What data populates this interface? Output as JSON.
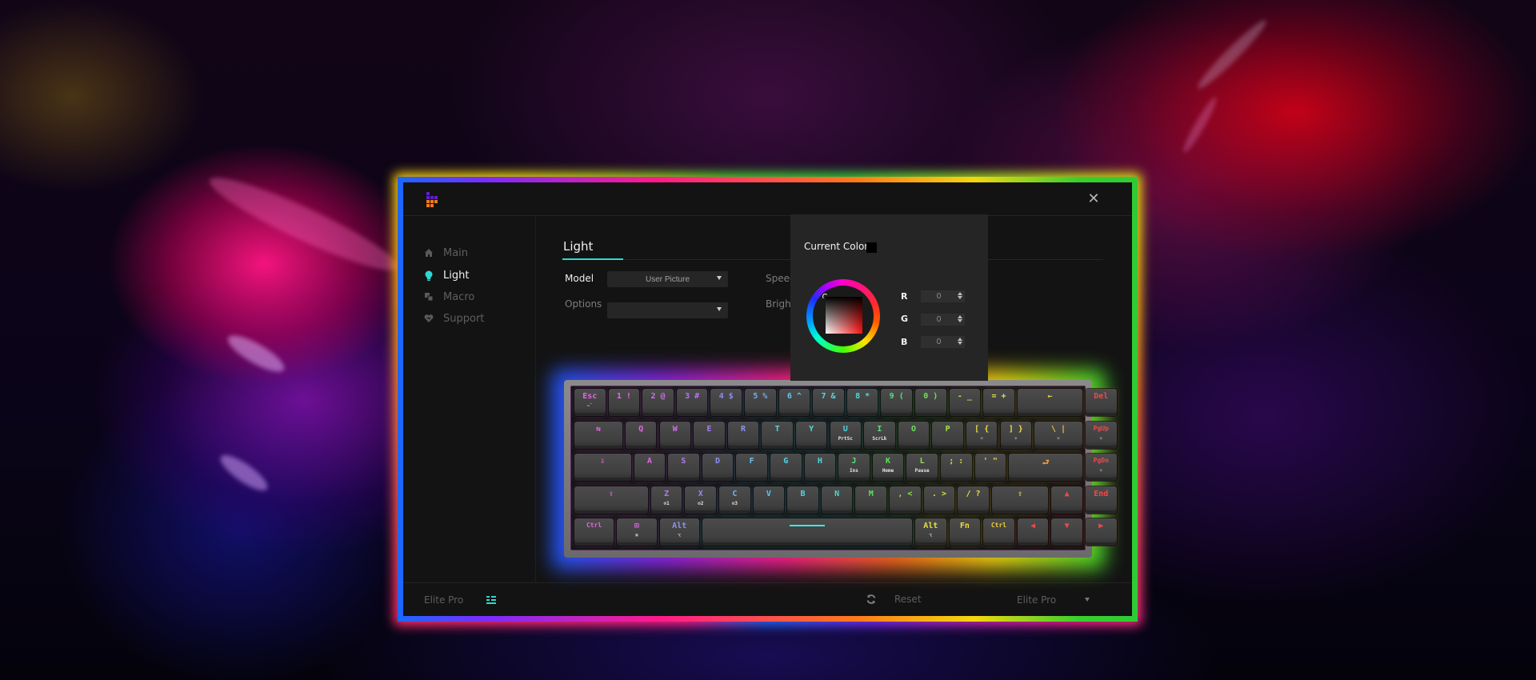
{
  "app": {
    "logo_name": "brand-logo",
    "close_label": "✕",
    "accent_color": "#2ed8d2",
    "logo_colors": [
      "#5d1fd0",
      "#f07a1a"
    ]
  },
  "sidebar": {
    "items": [
      {
        "label": "Main",
        "icon": "home-icon",
        "active": false
      },
      {
        "label": "Light",
        "icon": "lightbulb-icon",
        "active": true
      },
      {
        "label": "Macro",
        "icon": "macro-icon",
        "active": false
      },
      {
        "label": "Support",
        "icon": "heart-icon",
        "active": false
      }
    ]
  },
  "main": {
    "tab_title": "Light",
    "model_label": "Model",
    "model_value": "User Picture",
    "options_label": "Options",
    "options_value": "",
    "speed_label": "Speed",
    "brightness_label": "Brightr"
  },
  "color_picker": {
    "title": "Current Color",
    "current_color": "#000000",
    "channels": [
      {
        "label": "R",
        "value": "0"
      },
      {
        "label": "G",
        "value": "0"
      },
      {
        "label": "B",
        "value": "0"
      }
    ]
  },
  "footer": {
    "device_name": "Elite Pro",
    "reset_label": "Reset",
    "profile_value": "Elite Pro"
  },
  "keyboard": {
    "rows": [
      [
        {
          "l": "Esc",
          "s": "~`",
          "c": "#e465e8",
          "w": 1
        },
        {
          "l": "1 !",
          "c": "#e46ae8",
          "w": 1
        },
        {
          "l": "2 @",
          "c": "#d170ea",
          "w": 1
        },
        {
          "l": "3 #",
          "c": "#b777ec",
          "w": 1
        },
        {
          "l": "4 $",
          "c": "#8a8cf2",
          "w": 1
        },
        {
          "l": "5 %",
          "c": "#78a8f2",
          "w": 1
        },
        {
          "l": "6 ^",
          "c": "#63c7ef",
          "w": 1
        },
        {
          "l": "7 &",
          "c": "#58d3e6",
          "w": 1
        },
        {
          "l": "8 *",
          "c": "#4fdadb",
          "w": 1
        },
        {
          "l": "9 (",
          "c": "#56e07a",
          "w": 1
        },
        {
          "l": "0 )",
          "c": "#6fe256",
          "w": 1
        },
        {
          "l": "- _",
          "c": "#b4e04a",
          "w": 1
        },
        {
          "l": "= +",
          "c": "#e4e04a",
          "w": 1
        },
        {
          "l": "←",
          "c": "#f3d93a",
          "w": 2
        },
        {
          "l": "Del",
          "c": "#ee4a4a",
          "w": 1
        }
      ],
      [
        {
          "l": "⇆",
          "c": "#e465e8",
          "w": 1.5
        },
        {
          "l": "Q",
          "c": "#e266e8",
          "w": 1
        },
        {
          "l": "W",
          "c": "#cf6fea",
          "w": 1
        },
        {
          "l": "E",
          "c": "#a27ef0",
          "w": 1
        },
        {
          "l": "R",
          "c": "#8a93f2",
          "w": 1
        },
        {
          "l": "T",
          "c": "#5fd2ea",
          "w": 1
        },
        {
          "l": "Y",
          "c": "#53d6e4",
          "w": 1
        },
        {
          "l": "U",
          "s": "PrtSc",
          "c": "#4fd2dd",
          "w": 1
        },
        {
          "l": "I",
          "s": "ScrLk",
          "c": "#58e07a",
          "w": 1
        },
        {
          "l": "O",
          "c": "#6ee25a",
          "w": 1
        },
        {
          "l": "P",
          "c": "#9fe24b",
          "w": 1
        },
        {
          "l": "[ {",
          "s": "☼",
          "c": "#e6de44",
          "w": 1
        },
        {
          "l": "] }",
          "s": "☼",
          "c": "#eedb3c",
          "w": 1
        },
        {
          "l": "\\ |",
          "s": "☼",
          "c": "#f2c53a",
          "w": 1.5
        },
        {
          "l": "PgUp",
          "s": "☼",
          "c": "#ee4a4a",
          "w": 1
        }
      ],
      [
        {
          "l": "⇩",
          "c": "#e465e8",
          "w": 1.75
        },
        {
          "l": "A",
          "c": "#e266e8",
          "w": 1
        },
        {
          "l": "S",
          "c": "#b27cee",
          "w": 1
        },
        {
          "l": "D",
          "c": "#8d8ff2",
          "w": 1
        },
        {
          "l": "F",
          "c": "#68c3f0",
          "w": 1
        },
        {
          "l": "G",
          "c": "#58d2e8",
          "w": 1
        },
        {
          "l": "H",
          "c": "#4fd6df",
          "w": 1
        },
        {
          "l": "J",
          "s": "Ins",
          "c": "#5bdf7a",
          "w": 1
        },
        {
          "l": "K",
          "s": "Home",
          "c": "#62e05a",
          "w": 1
        },
        {
          "l": "L",
          "s": "Pause",
          "c": "#8fe24f",
          "w": 1
        },
        {
          "l": "; :",
          "c": "#e4de44",
          "w": 1
        },
        {
          "l": "' \"",
          "c": "#eedb3c",
          "w": 1
        },
        {
          "l": "⮐",
          "c": "#f0a23a",
          "w": 2.25
        },
        {
          "l": "PgDn",
          "s": "☼",
          "c": "#ee4a4a",
          "w": 1
        }
      ],
      [
        {
          "l": "⇧",
          "c": "#e465e8",
          "w": 2.25
        },
        {
          "l": "Z",
          "s": "⚙1",
          "c": "#b77aee",
          "w": 1
        },
        {
          "l": "X",
          "s": "⚙2",
          "c": "#9c84f0",
          "w": 1
        },
        {
          "l": "C",
          "s": "⚙3",
          "c": "#6fb4f0",
          "w": 1
        },
        {
          "l": "V",
          "c": "#5ac7ee",
          "w": 1
        },
        {
          "l": "B",
          "c": "#52d3e4",
          "w": 1
        },
        {
          "l": "N",
          "c": "#4fd8cf",
          "w": 1
        },
        {
          "l": "M",
          "c": "#5fe05c",
          "w": 1
        },
        {
          "l": ", <",
          "c": "#8ee04d",
          "w": 1
        },
        {
          "l": ". >",
          "c": "#dcde44",
          "w": 1
        },
        {
          "l": "/ ?",
          "c": "#eedb3c",
          "w": 1
        },
        {
          "l": "⇧",
          "c": "#f3d63a",
          "w": 1.75
        },
        {
          "l": "▲",
          "c": "#ee4a4a",
          "w": 1
        },
        {
          "l": "End",
          "c": "#ee4a4a",
          "w": 1
        }
      ],
      [
        {
          "l": "Ctrl",
          "c": "#e465e8",
          "w": 1.25
        },
        {
          "l": "⊞",
          "s": "⌘",
          "c": "#e266e8",
          "w": 1.25
        },
        {
          "l": "Alt",
          "s": "⌥",
          "c": "#8a93f2",
          "w": 1.25
        },
        {
          "l": "",
          "c": "#3fe6e8",
          "w": 6.25,
          "space": true
        },
        {
          "l": "Alt",
          "s": "⌥",
          "c": "#e6de44",
          "w": 1
        },
        {
          "l": "Fn",
          "c": "#eedb3c",
          "w": 1
        },
        {
          "l": "Ctrl",
          "c": "#f0cf3a",
          "w": 1
        },
        {
          "l": "◀",
          "c": "#ee4a4a",
          "w": 1
        },
        {
          "l": "▼",
          "c": "#ee4a4a",
          "w": 1
        },
        {
          "l": "▶",
          "c": "#ee4a4a",
          "w": 1
        }
      ]
    ]
  }
}
